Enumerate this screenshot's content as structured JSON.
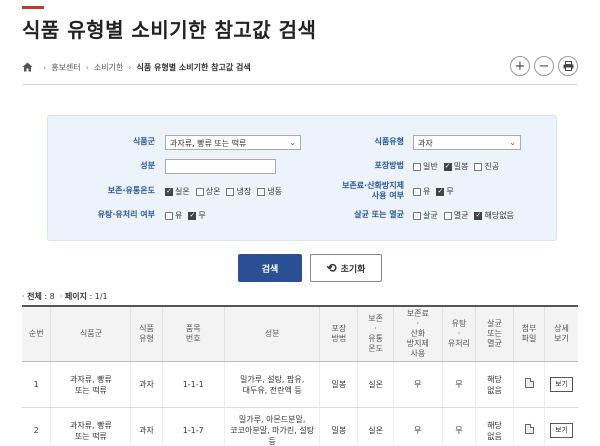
{
  "page": {
    "title": "식품 유형별 소비기한 참고값 검색"
  },
  "breadcrumb": [
    "홍보센터",
    "소비기한",
    "식품 유형별 소비기한 참고값 검색"
  ],
  "tools": {
    "zoom_in": "+",
    "zoom_out": "−"
  },
  "search": {
    "food_group": {
      "label": "식품군",
      "value": "과자류, 빵류 또는 떡류"
    },
    "food_type": {
      "label": "식품유형",
      "value": "과자"
    },
    "ingredient": {
      "label": "성분",
      "placeholder": ""
    },
    "packaging": {
      "label": "포장방법",
      "options": [
        {
          "label": "일반",
          "checked": false
        },
        {
          "label": "밀봉",
          "checked": true
        },
        {
          "label": "진공",
          "checked": false
        }
      ]
    },
    "storage_temp": {
      "label": "보존·유통온도",
      "options": [
        {
          "label": "실온",
          "checked": true
        },
        {
          "label": "상온",
          "checked": false
        },
        {
          "label": "냉장",
          "checked": false
        },
        {
          "label": "냉동",
          "checked": false
        }
      ]
    },
    "preservative": {
      "label_line1": "보존료·산화방지제",
      "label_line2": "사용 여부",
      "options": [
        {
          "label": "유",
          "checked": false
        },
        {
          "label": "무",
          "checked": true
        }
      ]
    },
    "oil_processing": {
      "label": "유탕·유처리 여부",
      "options": [
        {
          "label": "유",
          "checked": false
        },
        {
          "label": "무",
          "checked": true
        }
      ]
    },
    "sterilization": {
      "label": "살균 또는 멸균",
      "options": [
        {
          "label": "살균",
          "checked": false
        },
        {
          "label": "멸균",
          "checked": false
        },
        {
          "label": "해당없음",
          "checked": true
        }
      ]
    }
  },
  "buttons": {
    "search": "검색",
    "reset": "초기화"
  },
  "summary": {
    "total_label": "전체",
    "total": "8",
    "page_label": "페이지",
    "page": "1/1"
  },
  "table": {
    "headers": [
      "순번",
      "식품군",
      "식품\n유형",
      "품목\n번호",
      "성분",
      "포장\n방법",
      "보존\n·\n유통\n온도",
      "보존료\n·\n산화\n방지제\n사용",
      "유탕\n·\n유처리",
      "살균\n또는\n멸균",
      "첨부\n파일",
      "상세\n보기"
    ],
    "rows": [
      [
        "1",
        "과자류, 빵류\n또는 떡류",
        "과자",
        "1-1-1",
        "밀가루, 설탕, 팜유,\n대두유, 전란액 등",
        "밀봉",
        "실온",
        "무",
        "무",
        "해당\n없음",
        "",
        "보기"
      ],
      [
        "2",
        "과자류, 빵류\n또는 떡류",
        "과자",
        "1-1-7",
        "밀가루, 아몬드분말,\n코코아분말, 마가린, 설탕\n등",
        "밀봉",
        "실온",
        "무",
        "무",
        "해당\n없음",
        "",
        "보기"
      ]
    ]
  }
}
